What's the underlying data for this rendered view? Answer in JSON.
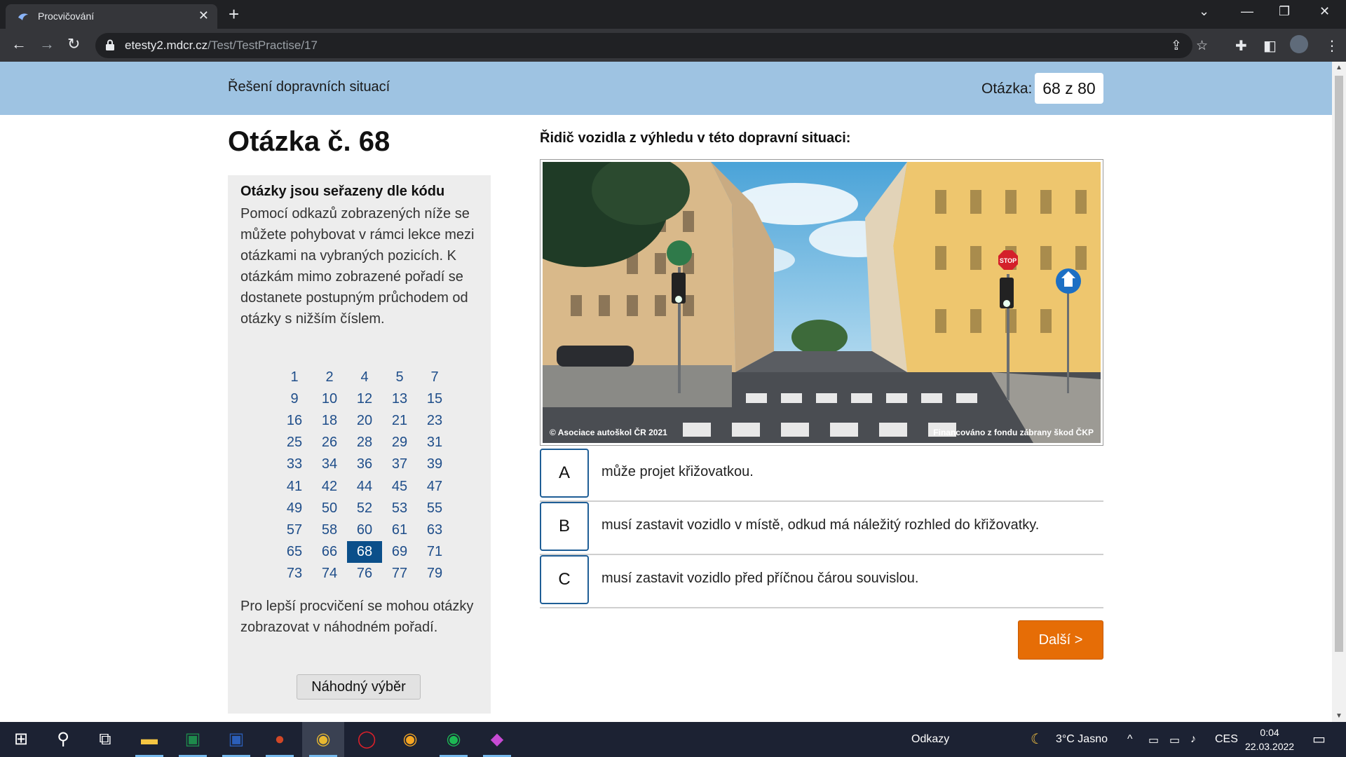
{
  "browser": {
    "tab_title": "Procvičování",
    "url_domain": "etesty2.mdcr.cz",
    "url_path": "/Test/TestPractise/17"
  },
  "header": {
    "title": "Řešení dopravních situací",
    "question_label": "Otázka:",
    "question_counter": "68 z 80"
  },
  "heading": "Otázka č. 68",
  "sidebar": {
    "title": "Otázky jsou seřazeny dle kódu",
    "description": "Pomocí odkazů zobrazených níže se můžete pohybovat v rámci lekce mezi otázkami na vybraných pozicích. K otázkám mimo zobrazené pořadí se dostanete postupným průchodem od otázky s nižším číslem.",
    "grid": [
      "1",
      "2",
      "4",
      "5",
      "7",
      "9",
      "10",
      "12",
      "13",
      "15",
      "16",
      "18",
      "20",
      "21",
      "23",
      "25",
      "26",
      "28",
      "29",
      "31",
      "33",
      "34",
      "36",
      "37",
      "39",
      "41",
      "42",
      "44",
      "45",
      "47",
      "49",
      "50",
      "52",
      "53",
      "55",
      "57",
      "58",
      "60",
      "61",
      "63",
      "65",
      "66",
      "68",
      "69",
      "71",
      "73",
      "74",
      "76",
      "77",
      "79"
    ],
    "active": "68",
    "note": "Pro lepší procvičení se mohou otázky zobrazovat v náhodném pořadí.",
    "random_button": "Náhodný výběr"
  },
  "question": {
    "text": "Řidič vozidla z výhledu v této dopravní situaci:",
    "image_caption_left": "© Asociace autoškol ČR 2021",
    "image_caption_right": "Financováno z fondu zábrany škod ČKP",
    "stop_sign": "STOP"
  },
  "answers": [
    {
      "letter": "A",
      "text": "může projet křižovatkou."
    },
    {
      "letter": "B",
      "text": "musí zastavit vozidlo v místě, odkud má náležitý rozhled do křižovatky."
    },
    {
      "letter": "C",
      "text": "musí zastavit vozidlo před příčnou čárou souvislou."
    }
  ],
  "next_button": "Další >",
  "taskbar": {
    "links_label": "Odkazy",
    "weather": "3°C  Jasno",
    "language": "CES",
    "time": "0:04",
    "date": "22.03.2022"
  },
  "colors": {
    "banner": "#9ec3e2",
    "accent_orange": "#e66d06",
    "active_cell": "#0b4f8a",
    "answer_border": "#1f5e96"
  }
}
